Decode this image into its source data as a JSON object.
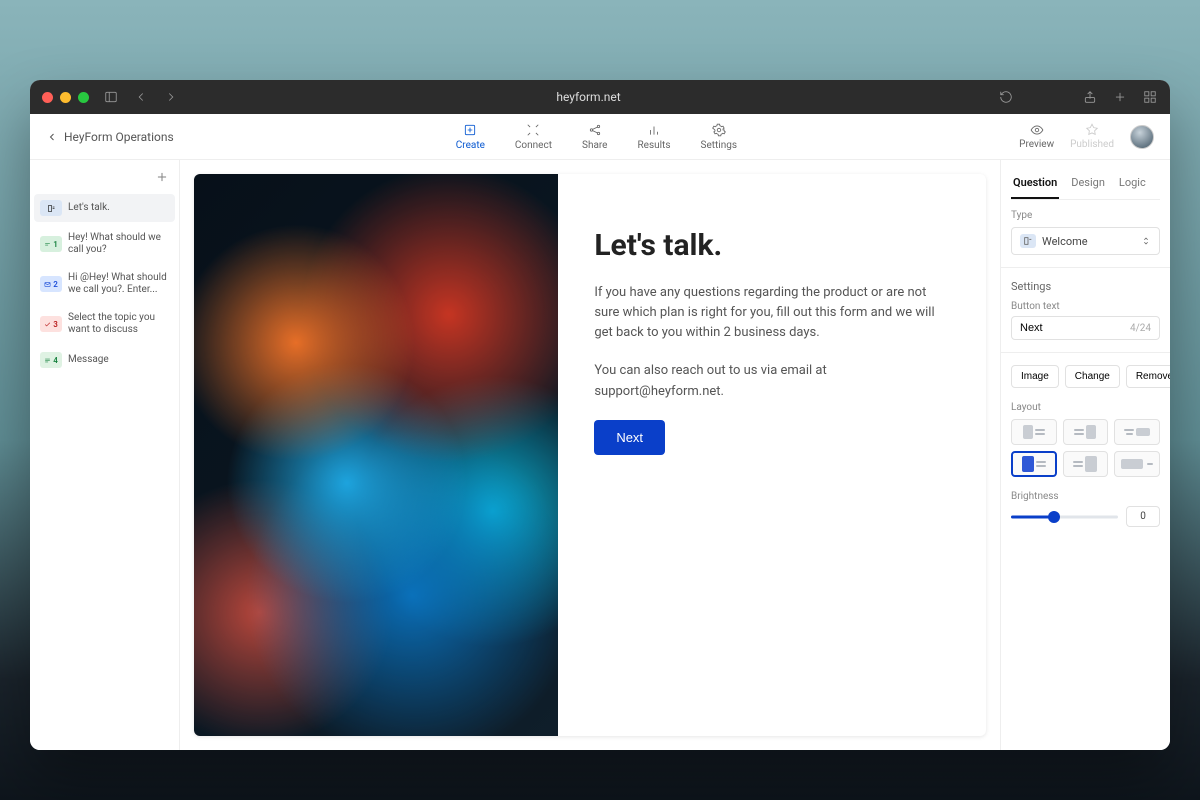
{
  "browser": {
    "url": "heyform.net"
  },
  "header": {
    "back_label": "HeyForm Operations",
    "tabs": {
      "create": "Create",
      "connect": "Connect",
      "share": "Share",
      "results": "Results",
      "settings": "Settings"
    },
    "preview": "Preview",
    "published": "Published"
  },
  "sidebar": {
    "section": "",
    "items": [
      {
        "badge": "",
        "label": "Let's talk."
      },
      {
        "badge": "1",
        "label": "Hey! What should we call you?"
      },
      {
        "badge": "2",
        "label": "Hi @Hey! What should we call you?. Enter..."
      },
      {
        "badge": "3",
        "label": "Select the topic you want to discuss"
      },
      {
        "badge": "4",
        "label": "Message"
      }
    ]
  },
  "canvas": {
    "title": "Let's talk.",
    "para1": "If you have any questions regarding the product or are not sure which plan is right for you, fill out this form and we will get back to you within 2 business days.",
    "para2": "You can also reach out to us via email at support@heyform.net.",
    "button": "Next"
  },
  "rightpanel": {
    "tabs": {
      "question": "Question",
      "design": "Design",
      "logic": "Logic"
    },
    "type_label": "Type",
    "type_value": "Welcome",
    "settings_title": "Settings",
    "buttontext_label": "Button text",
    "buttontext_value": "Next",
    "buttontext_counter": "4/24",
    "image_label": "Image",
    "change_btn": "Change",
    "remove_btn": "Remove",
    "layout_label": "Layout",
    "brightness_label": "Brightness",
    "brightness_value": "0"
  }
}
